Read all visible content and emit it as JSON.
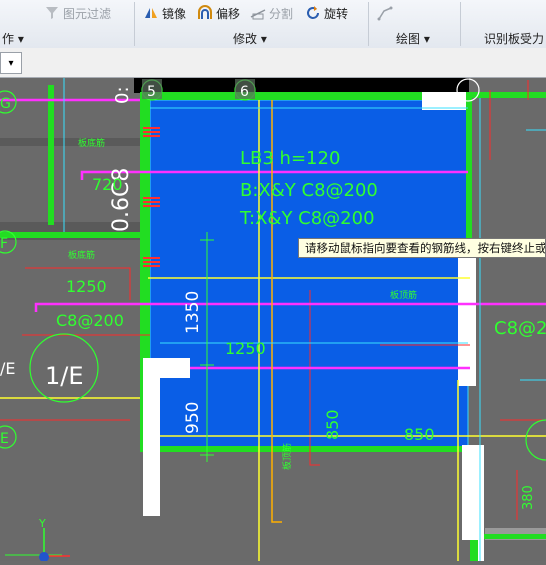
{
  "ribbon": {
    "filter": "图元过滤",
    "mirror": "镜像",
    "offset": "偏移",
    "split": "分割",
    "rotate": "旋转",
    "group_left": "作",
    "group_modify": "修改",
    "group_draw": "绘图",
    "group_recognize": "识别板受力"
  },
  "canvas": {
    "axis_5": "5",
    "axis_6": "6",
    "axis_g": "G",
    "axis_f": "F",
    "axis_1e_small": "/E",
    "axis_1e": "1/E",
    "axis_e": "E",
    "slab_name": "LB3 h=120",
    "slab_bottom": "B:X&Y C8@200",
    "slab_top": "T:X&Y C8@200",
    "rebar_left": "0.6C8",
    "rebar_left_small": "0:",
    "dim_1350": "1350",
    "dim_950": "950",
    "dim_850a": "850",
    "dim_850b": "850",
    "dim_1250a": "1250",
    "dim_1250b": "1250",
    "rebar_c8_200": "C8@200",
    "rebar_c8_20": "C8@20",
    "dim_720": "720",
    "dim_380": "380",
    "ucs_y": "Y",
    "tag_green1": "板底筋",
    "tag_green2": "板底筋",
    "tag_green3": "板顶筋",
    "tag_green4": "板顶筋"
  },
  "tooltip": "请移动鼠标指向要查看的钢筋线，按右键终止或"
}
